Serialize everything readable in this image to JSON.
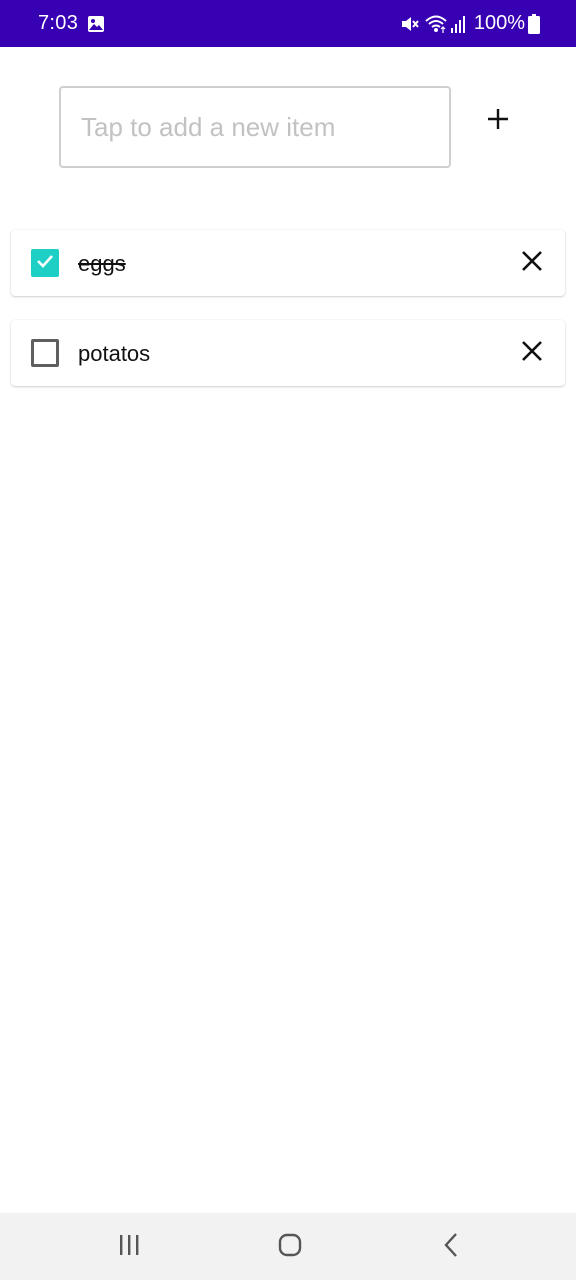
{
  "status_bar": {
    "time": "7:03",
    "battery_percent": "100%",
    "background_color": "#3700b3",
    "icons": [
      "image-icon",
      "mute-icon",
      "wifi-icon",
      "signal-icon",
      "battery-icon"
    ]
  },
  "add_item": {
    "placeholder": "Tap to add a new item",
    "value": "",
    "add_icon": "plus-icon"
  },
  "items": [
    {
      "label": "eggs",
      "checked": true
    },
    {
      "label": "potatos",
      "checked": false
    }
  ],
  "colors": {
    "accent": "#1ecfc6",
    "status_bar": "#3700b3"
  },
  "nav_bar": {
    "icons": [
      "recents-icon",
      "home-icon",
      "back-icon"
    ]
  }
}
